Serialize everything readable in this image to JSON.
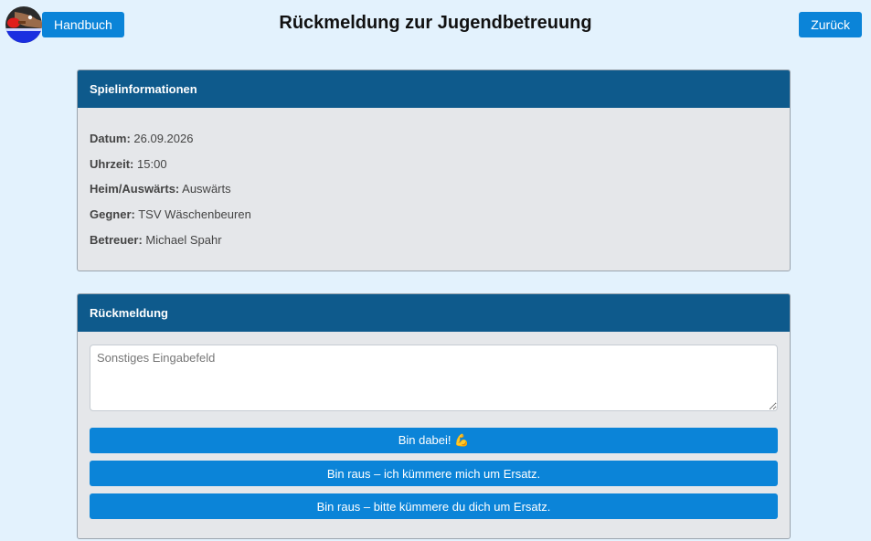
{
  "header": {
    "manual_label": "Handbuch",
    "title": "Rückmeldung zur Jugendbetreuung",
    "back_label": "Zurück",
    "logo_icon": "table-tennis-logo-icon"
  },
  "game_info": {
    "heading": "Spielinformationen",
    "rows": [
      {
        "label": "Datum:",
        "value": "26.09.2026"
      },
      {
        "label": "Uhrzeit:",
        "value": "15:00"
      },
      {
        "label": "Heim/Auswärts:",
        "value": "Auswärts"
      },
      {
        "label": "Gegner:",
        "value": "TSV Wäschenbeuren"
      },
      {
        "label": "Betreuer:",
        "value": "Michael Spahr"
      }
    ]
  },
  "feedback": {
    "heading": "Rückmeldung",
    "textarea_placeholder": "Sonstiges Eingabefeld",
    "textarea_value": "",
    "buttons": {
      "in": "Bin dabei! 💪",
      "out_self": "Bin raus – ich kümmere mich um Ersatz.",
      "out_other": "Bin raus – bitte kümmere du dich um Ersatz."
    }
  },
  "colors": {
    "background": "#e3f2fd",
    "button": "#0b84d8",
    "card_header": "#0e5a8c",
    "card_body": "#e5e7ea"
  }
}
